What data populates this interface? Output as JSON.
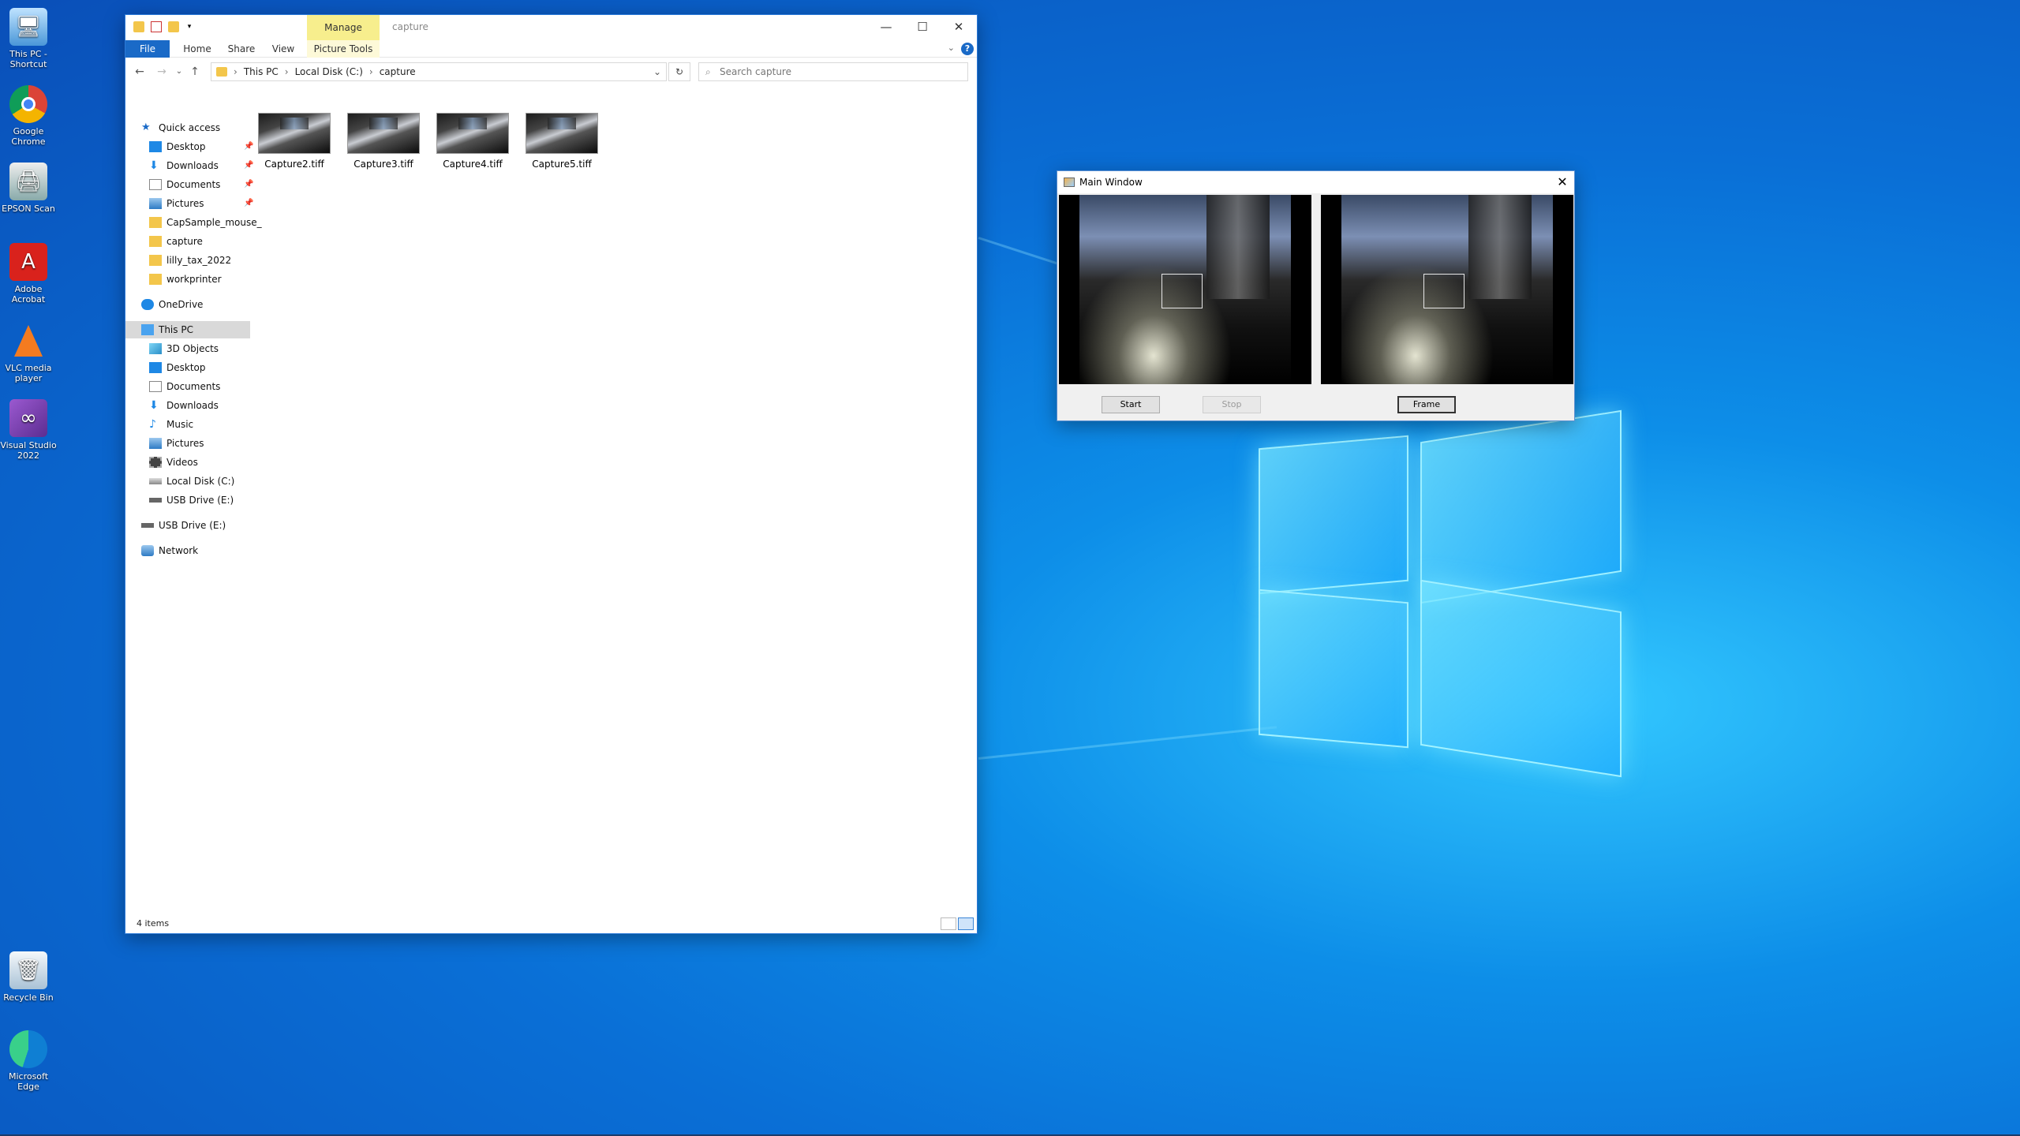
{
  "desktop": {
    "icons": [
      {
        "label": "This PC - Shortcut"
      },
      {
        "label": "Google Chrome"
      },
      {
        "label": "EPSON Scan"
      },
      {
        "label": "Adobe Acrobat"
      },
      {
        "label": "VLC media player"
      },
      {
        "label": "Visual Studio 2022"
      },
      {
        "label": "Recycle Bin"
      },
      {
        "label": "Microsoft Edge"
      }
    ]
  },
  "explorer": {
    "contextual_tab": "Manage",
    "title": "capture",
    "ribbon_tabs": {
      "file": "File",
      "home": "Home",
      "share": "Share",
      "view": "View",
      "picture_tools": "Picture Tools"
    },
    "breadcrumb": [
      "This PC",
      "Local Disk (C:)",
      "capture"
    ],
    "search_placeholder": "Search capture",
    "nav": {
      "quick_access": "Quick access",
      "quick_items": [
        "Desktop",
        "Downloads",
        "Documents",
        "Pictures",
        "CapSample_mouse_",
        "capture",
        "lilly_tax_2022",
        "workprinter"
      ],
      "onedrive": "OneDrive",
      "this_pc": "This PC",
      "pc_items": [
        "3D Objects",
        "Desktop",
        "Documents",
        "Downloads",
        "Music",
        "Pictures",
        "Videos",
        "Local Disk (C:)",
        "USB Drive (E:)"
      ],
      "usb": "USB Drive (E:)",
      "network": "Network"
    },
    "files": [
      "Capture2.tiff",
      "Capture3.tiff",
      "Capture4.tiff",
      "Capture5.tiff"
    ],
    "status": "4 items"
  },
  "mainwindow": {
    "title": "Main Window",
    "buttons": {
      "start": "Start",
      "stop": "Stop",
      "frame": "Frame"
    }
  },
  "colors": {
    "accent": "#1a6ac7",
    "manage_tab": "#f7ee8d"
  }
}
